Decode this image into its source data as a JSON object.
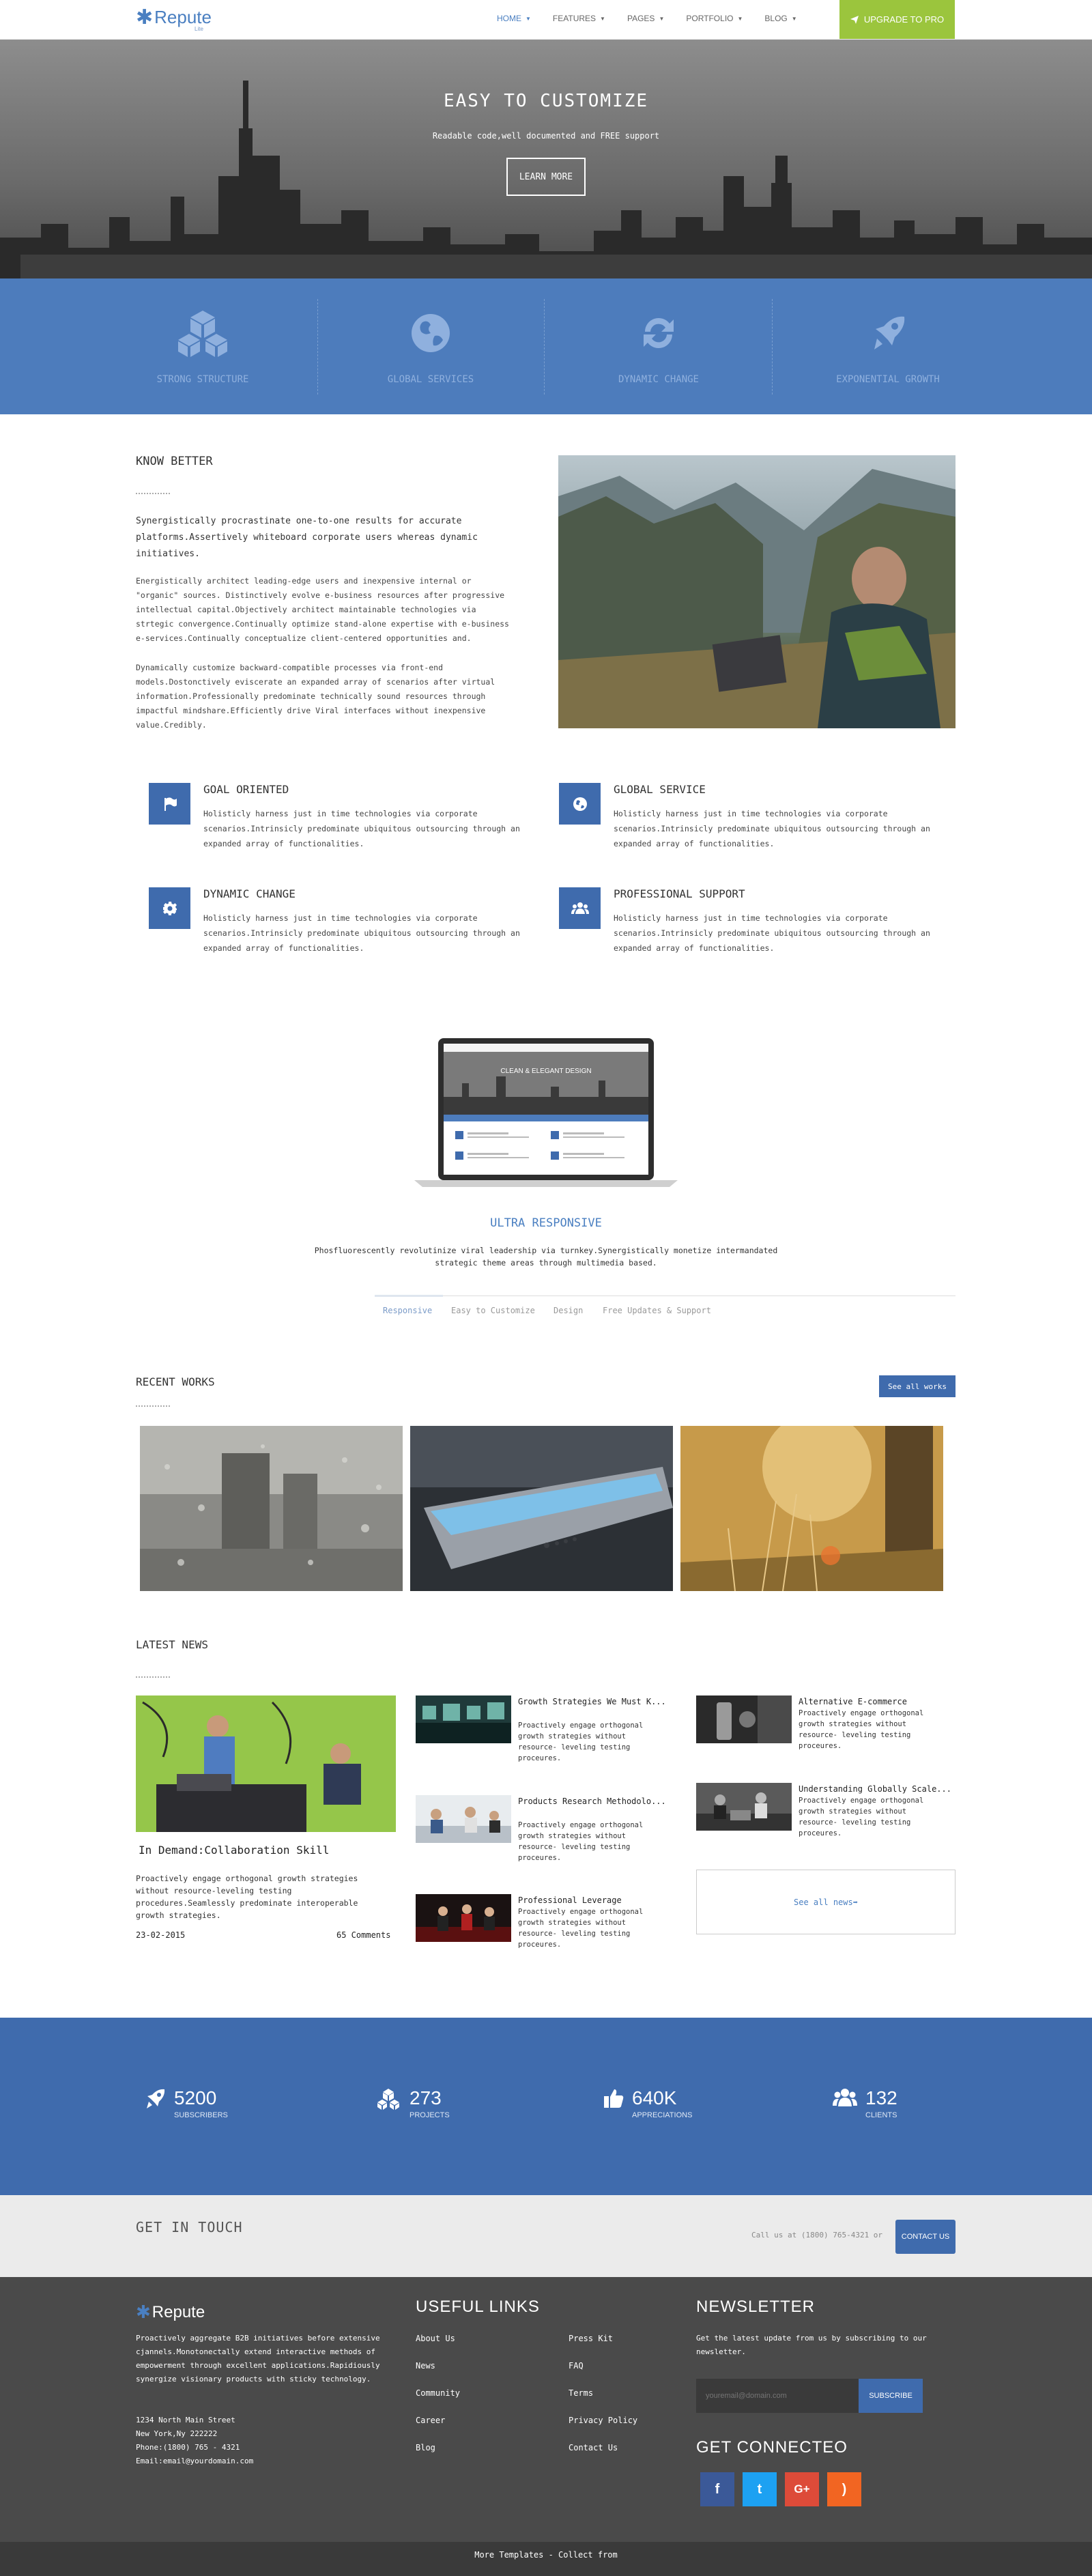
{
  "nav": {
    "logo": "Repute",
    "logo_sub": "Lite",
    "menu": [
      "HOME",
      "FEATURES",
      "PAGES",
      "PORTFOLIO",
      "BLOG"
    ],
    "cta": "UPGRADE TO PRO",
    "accent": "#9bc53d"
  },
  "hero": {
    "title": "EASY TO CUSTOMIZE",
    "subtitle": "Readable code,well documented and FREE support",
    "button": "LEARN MORE"
  },
  "band": {
    "color": "#4d7cbc",
    "items": [
      {
        "label": "STRONG STRUCTURE",
        "icon": "cubes-icon"
      },
      {
        "label": "GLOBAL SERVICES",
        "icon": "globe-icon"
      },
      {
        "label": "DYNAMIC CHANGE",
        "icon": "refresh-icon"
      },
      {
        "label": "EXPONENTIAL GROWTH",
        "icon": "rocket-icon"
      }
    ]
  },
  "know_better": {
    "title": "KNOW BETTER",
    "lead": "Synergistically procrastinate one-to-one results for accurate platforms.Assertively whiteboard corporate users whereas dynamic initiatives.",
    "p1": "Energistically architect leading-edge users and inexpensive internal or \"organic\" sources. Distinctively evolve e-business resources after progressive intellectual capital.Objectively architect maintainable technologies via strtegic convergence.Continually optimize stand-alone expertise with e-business e-services.Continually conceptualize client-centered opportunities and.",
    "p2": "Dynamically customize backward-compatible processes via front-end models.Dostonctively eviscerate an expanded array of scenarios after virtual information.Professionally predominate technically sound resources through impactful mindshare.Efficiently drive Viral interfaces without inexpensive value.Credibly."
  },
  "features": [
    {
      "title": "GOAL ORIENTED",
      "icon": "flag-icon",
      "text": "Holisticly harness just in time technologies via corporate scenarios.Intrinsicly predominate ubiquitous outsourcing through an expanded array of functionalities."
    },
    {
      "title": "GLOBAL SERVICE",
      "icon": "globe-icon",
      "text": "Holisticly harness just in time technologies via corporate scenarios.Intrinsicly predominate ubiquitous outsourcing through an expanded array of functionalities."
    },
    {
      "title": "DYNAMIC CHANGE",
      "icon": "gear-icon",
      "text": "Holisticly harness just in time technologies via corporate scenarios.Intrinsicly predominate ubiquitous outsourcing through an expanded array of functionalities."
    },
    {
      "title": "PROFESSIONAL SUPPORT",
      "icon": "users-icon",
      "text": "Holisticly harness just in time technologies via corporate scenarios.Intrinsicly predominate ubiquitous outsourcing through an expanded array of functionalities."
    }
  ],
  "ultra": {
    "title": "ULTRA RESPONSIVE",
    "text": "Phosfluorescently revolutinize viral leadership via turnkey.Synergistically monetize intermandated strategic theme areas through multimedia based.",
    "tabs": [
      "Responsive",
      "Easy to Customize",
      "Design",
      "Free Updates & Support"
    ],
    "active_tab": "Responsive",
    "screen_banner": "CLEAN & ELEGANT DESIGN"
  },
  "recent_works": {
    "title": "RECENT WORKS",
    "button": "See all works"
  },
  "latest_news": {
    "title": "LATEST NEWS",
    "main": {
      "title": "In Demand:Collaboration Skill",
      "text": "Proactively engage orthogonal growth strategies without resource-leveling testing procedures.Seamlessly predominate interoperable growth strategies.",
      "date": "23-02-2015",
      "comments": "65 Comments"
    },
    "items": [
      {
        "title": "Growth Strategies We Must K...",
        "text": "Proactively engage orthogonal growth strategies without resource- leveling testing proceures."
      },
      {
        "title": "Products Research Methodolo...",
        "text": "Proactively engage orthogonal growth strategies without resource- leveling testing proceures."
      },
      {
        "title": "Professional Leverage",
        "text": "Proactively engage orthogonal growth strategies without resource- leveling testing proceures."
      },
      {
        "title": "Alternative E-commerce",
        "text": "Proactively engage orthogonal growth strategies without resource- leveling testing proceures."
      },
      {
        "title": "Understanding Globally Scale...",
        "text": "Proactively engage orthogonal growth strategies without resource- leveling testing proceures."
      }
    ],
    "see_all": "See all news➡"
  },
  "stats": [
    {
      "value": "5200",
      "label": "SUBSCRIBERS",
      "icon": "rocket-icon"
    },
    {
      "value": "273",
      "label": "PROJECTS",
      "icon": "cubes-icon"
    },
    {
      "value": "640K",
      "label": "APPRECIATIONS",
      "icon": "thumbs-up-icon"
    },
    {
      "value": "132",
      "label": "CLIENTS",
      "icon": "users-icon"
    }
  ],
  "get_in_touch": {
    "title": "GET IN TOUCH",
    "call": "Call us at (1800) 765-4321 or",
    "button": "CONTACT US"
  },
  "footer": {
    "logo": "Repute",
    "about": "Proactively aggregate B2B initiatives before extensive cjannels.Monotonectally extend interactive methods of empowerment through excellent applications.Rapidiously synergize visionary products with sticky technology.",
    "address": [
      "1234 North Main Street",
      "New York,Ny 222222",
      "Phone:(1800) 765 - 4321",
      "Email:email@yourdomain.com"
    ],
    "useful_links_title": "USEFUL LINKS",
    "links_col1": [
      "About Us",
      "News",
      "Community",
      "Career",
      "Blog"
    ],
    "links_col2": [
      "Press Kit",
      "FAQ",
      "Terms",
      "Privacy Policy",
      "Contact Us"
    ],
    "newsletter_title": "NEWSLETTER",
    "newsletter_text": "Get the latest update from us by subscribing to our newsletter.",
    "email_placeholder": "youremail@domain.com",
    "subscribe": "SUBSCRIBE",
    "connect_title": "GET CONNECTEO",
    "social": [
      {
        "name": "facebook",
        "glyph": "f",
        "color": "#3b5998"
      },
      {
        "name": "twitter",
        "glyph": "t",
        "color": "#1da1f2"
      },
      {
        "name": "google-plus",
        "glyph": "G+",
        "color": "#dd4b39"
      },
      {
        "name": "rss",
        "glyph": ")",
        "color": "#f26522"
      }
    ],
    "bottom": "More Templates - Collect from"
  }
}
